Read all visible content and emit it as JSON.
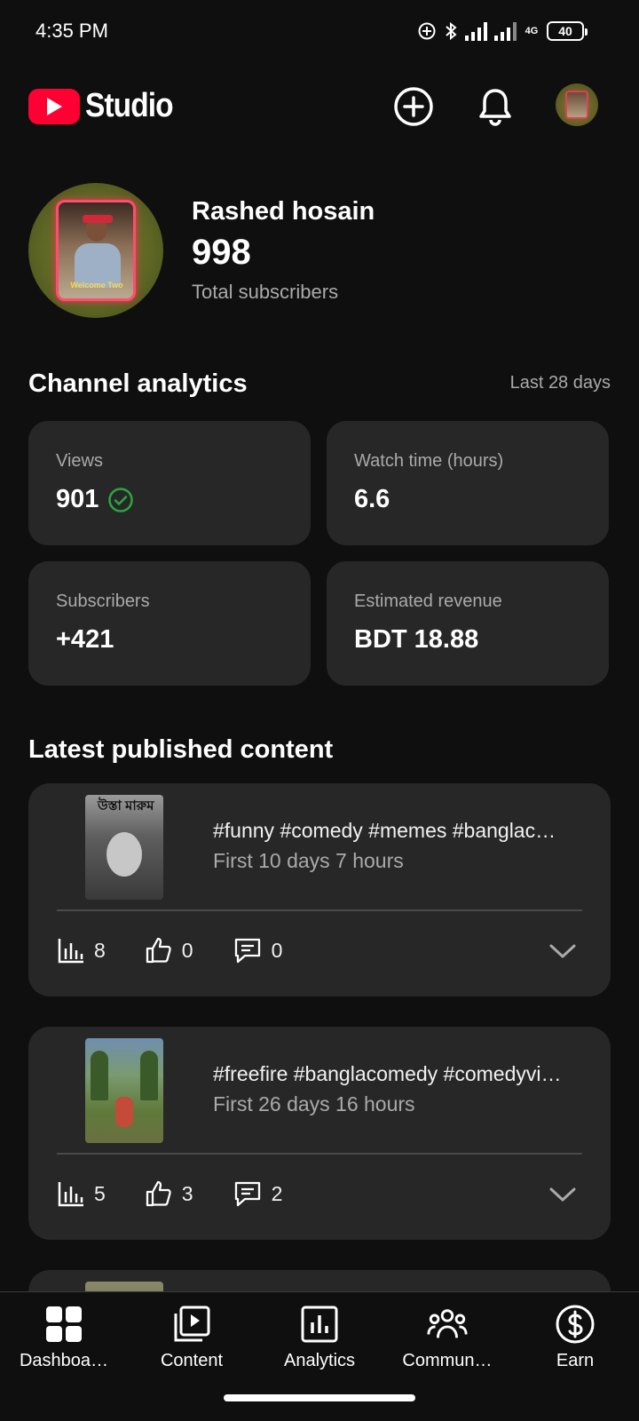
{
  "status_bar": {
    "time": "4:35 PM",
    "network": "4G",
    "battery": "40"
  },
  "app": {
    "brand": "Studio",
    "brand_color": "#ff0033"
  },
  "channel": {
    "name": "Rashed hosain",
    "subscribers": "998",
    "subscribers_label": "Total subscribers",
    "avatar_caption": "Welcome Two"
  },
  "analytics": {
    "title": "Channel analytics",
    "period": "Last 28 days",
    "cards": [
      {
        "label": "Views",
        "value": "901",
        "verified": true
      },
      {
        "label": "Watch time (hours)",
        "value": "6.6"
      },
      {
        "label": "Subscribers",
        "value": "+421"
      },
      {
        "label": "Estimated revenue",
        "value": "BDT 18.88"
      }
    ],
    "check_color": "#2ba640"
  },
  "latest": {
    "title": "Latest published content",
    "items": [
      {
        "title": "#funny #comedy #memes #banglac…",
        "meta": "First 10 days 7 hours",
        "views": "8",
        "likes": "0",
        "comments": "0",
        "thumb_text": "উস্তা মারুম"
      },
      {
        "title": "#freefire #banglacomedy #comedyvi…",
        "meta": "First 26 days 16 hours",
        "views": "5",
        "likes": "3",
        "comments": "2"
      }
    ]
  },
  "nav": {
    "items": [
      {
        "label": "Dashboa…",
        "icon": "dashboard-icon"
      },
      {
        "label": "Content",
        "icon": "content-icon"
      },
      {
        "label": "Analytics",
        "icon": "analytics-icon"
      },
      {
        "label": "Commun…",
        "icon": "community-icon"
      },
      {
        "label": "Earn",
        "icon": "earn-icon"
      }
    ]
  }
}
